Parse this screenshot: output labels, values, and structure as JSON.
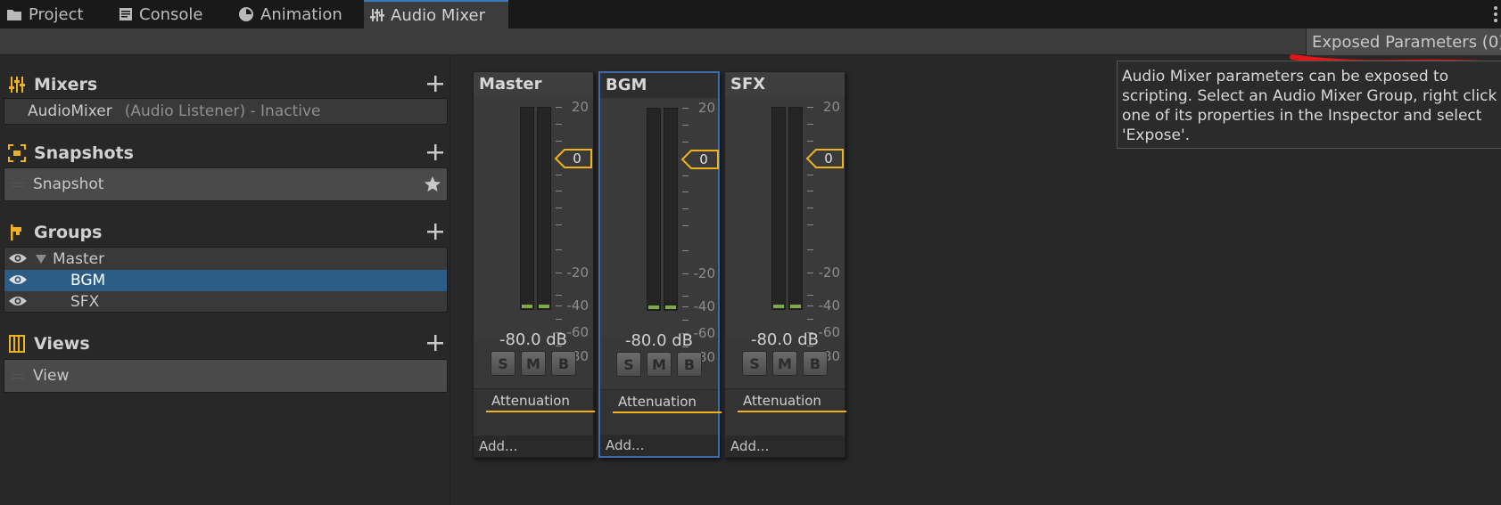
{
  "tabs": [
    {
      "label": "Project",
      "icon": "folder-icon"
    },
    {
      "label": "Console",
      "icon": "console-icon"
    },
    {
      "label": "Animation",
      "icon": "clock-icon"
    },
    {
      "label": "Audio Mixer",
      "icon": "audio-mixer-icon",
      "active": true
    }
  ],
  "toolbar": {
    "exposed_params_label": "Exposed Parameters (0)"
  },
  "tooltip": {
    "text": "Audio Mixer parameters can be exposed to\nscripting. Select an Audio Mixer Group, right click\none of its properties in the Inspector and select\n'Expose'."
  },
  "left": {
    "mixers": {
      "title": "Mixers",
      "items": [
        {
          "name": "AudioMixer",
          "status": "(Audio Listener) - Inactive"
        }
      ]
    },
    "snapshots": {
      "title": "Snapshots",
      "items": [
        {
          "name": "Snapshot",
          "starred": true
        }
      ]
    },
    "groups": {
      "title": "Groups",
      "items": [
        {
          "name": "Master",
          "expanded": true,
          "depth": 0
        },
        {
          "name": "BGM",
          "depth": 1,
          "selected": true
        },
        {
          "name": "SFX",
          "depth": 1
        }
      ]
    },
    "views": {
      "title": "Views",
      "items": [
        {
          "name": "View"
        }
      ]
    }
  },
  "scale_labels": [
    "20",
    "-20",
    "-40",
    "-60",
    "-80"
  ],
  "strips": [
    {
      "name": "Master",
      "fader_value": "0",
      "db": "-80.0 dB",
      "buttons": [
        "S",
        "M",
        "B"
      ],
      "effect": "Attenuation",
      "add": "Add...",
      "selected": false
    },
    {
      "name": "BGM",
      "fader_value": "0",
      "db": "-80.0 dB",
      "buttons": [
        "S",
        "M",
        "B"
      ],
      "effect": "Attenuation",
      "add": "Add...",
      "selected": true
    },
    {
      "name": "SFX",
      "fader_value": "0",
      "db": "-80.0 dB",
      "buttons": [
        "S",
        "M",
        "B"
      ],
      "effect": "Attenuation",
      "add": "Add...",
      "selected": false
    }
  ],
  "colors": {
    "accent_yellow": "#f0b21e",
    "selection_blue": "#2c5d87",
    "meter_green": "#7da94a",
    "annotation_red": "#e01818"
  }
}
